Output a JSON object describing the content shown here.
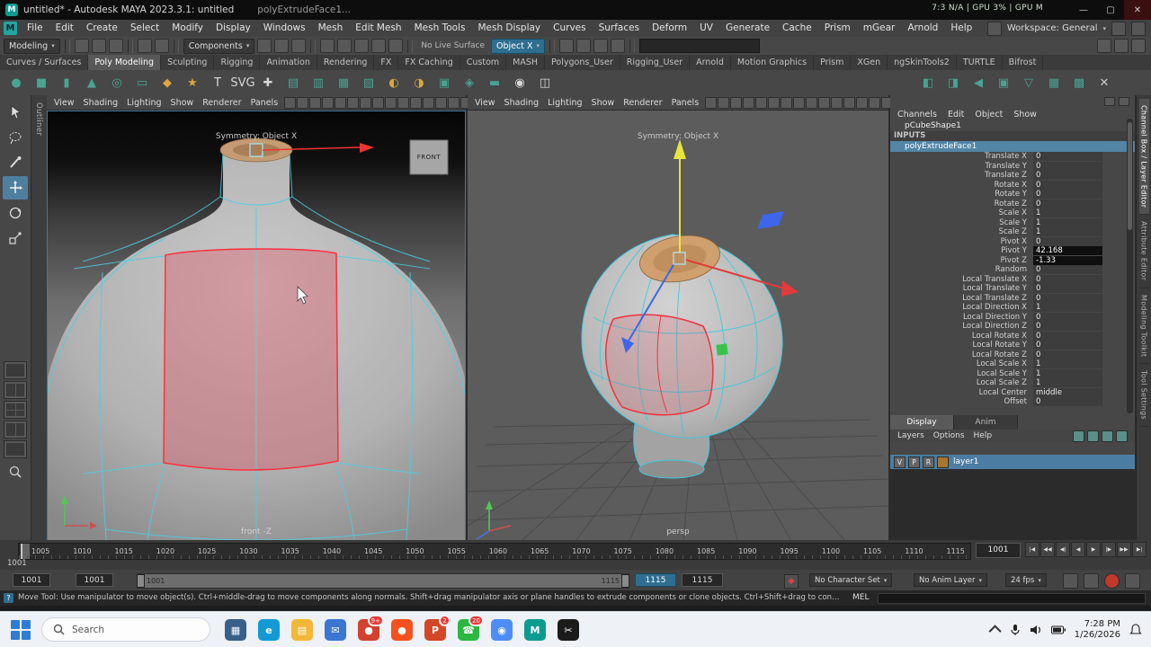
{
  "colors": {
    "accent": "#4f7f9f",
    "symmetry_highlight": "#2e6e90",
    "selected_face": "#ff2f3e",
    "wireframe": "#4ccfe4",
    "viewport_bg": "#5c5c5c",
    "taskbar_bg": "#eef1f6"
  },
  "titlebar": {
    "title": "untitled* - Autodesk MAYA 2023.3.1: untitled",
    "secondary": "polyExtrudeFace1...",
    "perf_overlay": "7:3  N/A | GPU 3% | GPU M",
    "window_controls": [
      "—",
      "▢",
      "✕"
    ]
  },
  "menubar": {
    "logo": "M",
    "items": [
      "File",
      "Edit",
      "Create",
      "Select",
      "Modify",
      "Display",
      "Windows",
      "Mesh",
      "Edit Mesh",
      "Mesh Tools",
      "Mesh Display",
      "Curves",
      "Surfaces",
      "Deform",
      "UV",
      "Generate",
      "Cache",
      "Prism",
      "mGear",
      "Arnold",
      "Help"
    ],
    "workspace": "Workspace: General"
  },
  "statusline": {
    "menuset": "Modeling",
    "selection_mode": "Components",
    "live_surface": "No Live Surface",
    "symmetry": "Object X",
    "field_value": ""
  },
  "shelf": {
    "tabs": [
      {
        "label": "Curves / Surfaces"
      },
      {
        "label": "Poly Modeling",
        "active": true
      },
      {
        "label": "Sculpting"
      },
      {
        "label": "Rigging"
      },
      {
        "label": "Animation"
      },
      {
        "label": "Rendering"
      },
      {
        "label": "FX"
      },
      {
        "label": "FX Caching"
      },
      {
        "label": "Custom"
      },
      {
        "label": "MASH"
      },
      {
        "label": "Polygons_User"
      },
      {
        "label": "Rigging_User"
      },
      {
        "label": "Arnold"
      },
      {
        "label": "Motion Graphics"
      },
      {
        "label": "Prism"
      },
      {
        "label": "XGen"
      },
      {
        "label": "ngSkinTools2"
      },
      {
        "label": "TURTLE"
      },
      {
        "label": "Bifrost"
      }
    ],
    "icons": [
      {
        "name": "poly-sphere",
        "glyph": "●",
        "color": "#49a391"
      },
      {
        "name": "poly-cube",
        "glyph": "■",
        "color": "#49a391"
      },
      {
        "name": "poly-cylinder",
        "glyph": "▮",
        "color": "#49a391"
      },
      {
        "name": "poly-cone",
        "glyph": "▲",
        "color": "#49a391"
      },
      {
        "name": "poly-torus",
        "glyph": "◎",
        "color": "#49a391"
      },
      {
        "name": "poly-plane",
        "glyph": "▭",
        "color": "#49a391"
      },
      {
        "name": "platonic-solid",
        "glyph": "◆",
        "color": "#dca53c"
      },
      {
        "name": "super-shape",
        "glyph": "★",
        "color": "#dca53c"
      },
      {
        "name": "type-tool",
        "glyph": "T",
        "color": "#d6d6d6"
      },
      {
        "name": "svg-tool",
        "glyph": "SVG",
        "color": "#d6d6d6"
      },
      {
        "name": "multi-cut",
        "glyph": "✚",
        "color": "#d6d6d6"
      },
      {
        "name": "combine",
        "glyph": "▤",
        "color": "#49a391"
      },
      {
        "name": "separate",
        "glyph": "▥",
        "color": "#49a391"
      },
      {
        "name": "smooth",
        "glyph": "▦",
        "color": "#49a391"
      },
      {
        "name": "subdivide",
        "glyph": "▧",
        "color": "#49a391"
      },
      {
        "name": "boolean-union",
        "glyph": "◐",
        "color": "#dca53c"
      },
      {
        "name": "boolean-difference",
        "glyph": "◑",
        "color": "#dca53c"
      },
      {
        "name": "extrude",
        "glyph": "▣",
        "color": "#49a391"
      },
      {
        "name": "bevel",
        "glyph": "◈",
        "color": "#49a391"
      },
      {
        "name": "bridge",
        "glyph": "▬",
        "color": "#49a391"
      },
      {
        "name": "target-weld",
        "glyph": "◉",
        "color": "#d6d6d6"
      },
      {
        "name": "quad-draw",
        "glyph": "◫",
        "color": "#d6d6d6"
      }
    ],
    "icons_right": [
      {
        "name": "mirror-geometry",
        "glyph": "◧",
        "color": "#49a391"
      },
      {
        "name": "symmetrize",
        "glyph": "◨",
        "color": "#49a391"
      },
      {
        "name": "flip",
        "glyph": "◀",
        "color": "#49a391"
      },
      {
        "name": "average-vertices",
        "glyph": "▣",
        "color": "#49a391"
      },
      {
        "name": "reduce",
        "glyph": "▽",
        "color": "#49a391"
      },
      {
        "name": "retopologize",
        "glyph": "▦",
        "color": "#49a391"
      },
      {
        "name": "remesh",
        "glyph": "▩",
        "color": "#49a391"
      },
      {
        "name": "delete-history",
        "glyph": "✕",
        "color": "#c9c9c9"
      }
    ]
  },
  "toolbox": {
    "tools": [
      "select-tool",
      "lasso-tool",
      "paint-select-tool",
      "move-tool",
      "rotate-tool",
      "scale-tool"
    ],
    "active_tool": "move-tool"
  },
  "outliner_label": "Outliner",
  "viewport_menus": [
    "View",
    "Shading",
    "Lighting",
    "Show",
    "Renderer",
    "Panels"
  ],
  "viewport_toolbar_icons": [
    "select-camera",
    "grid-toggle",
    "film-gate",
    "resolution-gate",
    "gate-mask",
    "field-chart",
    "safe-action",
    "safe-title",
    "camera-lock",
    "xray",
    "wireframe-on-shaded",
    "textured",
    "use-all-lights",
    "shadows",
    "occlusion",
    "motion-blur"
  ],
  "viewports": {
    "left": {
      "symmetry": "Symmetry: Object X",
      "camera": "front -Z",
      "image_plane": "FRONT"
    },
    "right": {
      "symmetry": "Symmetry: Object X",
      "camera": "persp"
    }
  },
  "channel_box": {
    "menus": [
      "Channels",
      "Edit",
      "Object",
      "Show"
    ],
    "node": "pCubeShape1",
    "section": "INPUTS",
    "selected_input": "polyExtrudeFace1",
    "attrs": [
      {
        "label": "Translate X",
        "value": "0"
      },
      {
        "label": "Translate Y",
        "value": "0"
      },
      {
        "label": "Translate Z",
        "value": "0"
      },
      {
        "label": "Rotate X",
        "value": "0"
      },
      {
        "label": "Rotate Y",
        "value": "0"
      },
      {
        "label": "Rotate Z",
        "value": "0"
      },
      {
        "label": "Scale X",
        "value": "1"
      },
      {
        "label": "Scale Y",
        "value": "1"
      },
      {
        "label": "Scale Z",
        "value": "1"
      },
      {
        "label": "Pivot X",
        "value": "0"
      },
      {
        "label": "Pivot Y",
        "value": "42.168",
        "hl": true
      },
      {
        "label": "Pivot Z",
        "value": "-1.33",
        "hl": true
      },
      {
        "label": "Random",
        "value": "0"
      },
      {
        "label": "Local Translate X",
        "value": "0"
      },
      {
        "label": "Local Translate Y",
        "value": "0"
      },
      {
        "label": "Local Translate Z",
        "value": "0"
      },
      {
        "label": "Local Direction X",
        "value": "1"
      },
      {
        "label": "Local Direction Y",
        "value": "0"
      },
      {
        "label": "Local Direction Z",
        "value": "0"
      },
      {
        "label": "Local Rotate X",
        "value": "0"
      },
      {
        "label": "Local Rotate Y",
        "value": "0"
      },
      {
        "label": "Local Rotate Z",
        "value": "0"
      },
      {
        "label": "Local Scale X",
        "value": "1"
      },
      {
        "label": "Local Scale Y",
        "value": "1"
      },
      {
        "label": "Local Scale Z",
        "value": "1"
      },
      {
        "label": "Local Center",
        "value": "middle"
      },
      {
        "label": "Offset",
        "value": "0"
      }
    ]
  },
  "layer_editor": {
    "tabs": [
      {
        "label": "Display",
        "active": true
      },
      {
        "label": "Anim"
      }
    ],
    "menus": [
      "Layers",
      "Options",
      "Help"
    ],
    "layer": {
      "name": "layer1",
      "toggles": [
        "V",
        "P",
        "R"
      ]
    }
  },
  "sidebar_tabs": [
    {
      "label": "Channel Box / Layer Editor",
      "active": true
    },
    {
      "label": "Attribute Editor"
    },
    {
      "label": "Modeling Toolkit"
    },
    {
      "label": "Tool Settings"
    }
  ],
  "timeline": {
    "ticks": [
      "1005",
      "1010",
      "1015",
      "1020",
      "1025",
      "1030",
      "1035",
      "1040",
      "1045",
      "1050",
      "1055",
      "1060",
      "1065",
      "1070",
      "1075",
      "1080",
      "1085",
      "1090",
      "1095",
      "1100",
      "1105",
      "1110",
      "1115"
    ],
    "current_frame": "1001",
    "frame_field": "1001",
    "playback": [
      {
        "name": "go-to-start",
        "glyph": "|◀"
      },
      {
        "name": "step-back-key",
        "glyph": "◀◀"
      },
      {
        "name": "step-back-frame",
        "glyph": "◀|"
      },
      {
        "name": "play-backwards",
        "glyph": "◀"
      },
      {
        "name": "play-forwards",
        "glyph": "▶"
      },
      {
        "name": "step-forward-frame",
        "glyph": "|▶"
      },
      {
        "name": "step-forward-key",
        "glyph": "▶▶"
      },
      {
        "name": "go-to-end",
        "glyph": "▶|"
      }
    ]
  },
  "range_slider": {
    "anim_start": "1001",
    "playback_start": "1001",
    "bar_start": "1001",
    "bar_end": "1115",
    "playback_end": "1115",
    "anim_end": "1115",
    "character_set": "No Character Set",
    "anim_layer": "No Anim Layer",
    "fps": "24 fps"
  },
  "help_line": {
    "text": "Move Tool: Use manipulator to move object(s). Ctrl+middle-drag to move components along normals. Shift+drag manipulator axis or plane handles to extrude components or clone objects. Ctrl+Shift+drag to constrain movement to a connected edge. Use D or INSERT to change the pivot position and axis orientation.",
    "mel": "MEL"
  },
  "taskbar": {
    "search_placeholder": "Search",
    "apps": [
      {
        "name": "task-view",
        "color": "#37608a",
        "glyph": "▦",
        "badge": ""
      },
      {
        "name": "edge-browser",
        "color": "#1499d6",
        "glyph": "e",
        "badge": ""
      },
      {
        "name": "file-explorer",
        "color": "#f3b83a",
        "glyph": "▤",
        "badge": ""
      },
      {
        "name": "mail",
        "color": "#3a76d2",
        "glyph": "✉",
        "badge": ""
      },
      {
        "name": "recorder-app",
        "color": "#d2422e",
        "glyph": "●",
        "badge": "9+"
      },
      {
        "name": "brave-browser",
        "color": "#f5511e",
        "glyph": "●",
        "badge": ""
      },
      {
        "name": "powerpoint",
        "color": "#d24726",
        "glyph": "P",
        "badge": "2"
      },
      {
        "name": "whatsapp",
        "color": "#2bb741",
        "glyph": "☎",
        "badge": "20"
      },
      {
        "name": "chrome-browser",
        "color": "#4e8df5",
        "glyph": "◉",
        "badge": ""
      },
      {
        "name": "maya-app",
        "color": "#0e9b8f",
        "glyph": "M",
        "badge": ""
      },
      {
        "name": "capcut",
        "color": "#1b1b1b",
        "glyph": "✂",
        "badge": ""
      }
    ],
    "time": "7:28 PM",
    "date": "1/26/2026"
  }
}
